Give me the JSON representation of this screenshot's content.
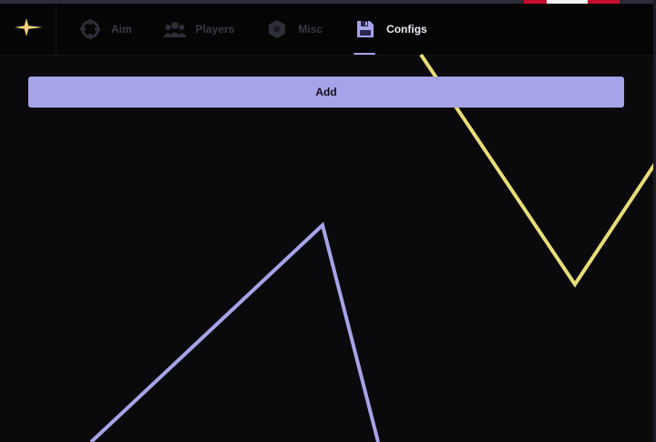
{
  "app": {
    "logo_icon": "sparkle-star-icon"
  },
  "tabs": [
    {
      "label": "Aim",
      "icon": "crosshair-icon",
      "active": false
    },
    {
      "label": "Players",
      "icon": "users-icon",
      "active": false
    },
    {
      "label": "Misc",
      "icon": "hexagon-icon",
      "active": false
    },
    {
      "label": "Configs",
      "icon": "floppy-disk-icon",
      "active": true
    }
  ],
  "configs": {
    "add_label": "Add"
  },
  "colors": {
    "accent": "#a6a3e8",
    "logo_gold": "#f2d27a",
    "yellow_line": "#e9dd7a",
    "background": "#0a0a0d",
    "topbar": "#050506",
    "inactive_tab": "#3a3a44",
    "active_tab_text": "#ececf2"
  }
}
